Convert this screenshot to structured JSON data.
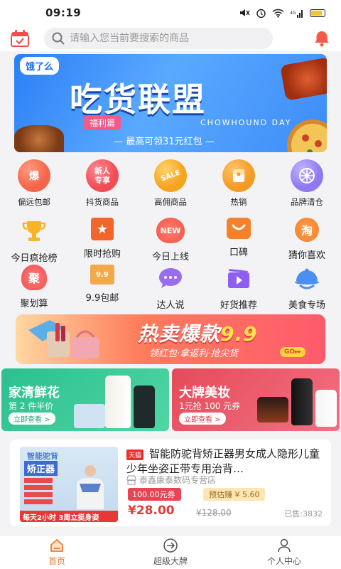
{
  "status_bar": {
    "time": "09:19",
    "icons": [
      "mute-icon",
      "alarm-icon",
      "wifi-icon",
      "signal-icon",
      "battery-icon"
    ],
    "battery_fraction": 0.85
  },
  "header": {
    "search_placeholder": "请输入您当前要搜索的商品",
    "left_icon": "calendar-check-icon",
    "right_icon": "bell-icon"
  },
  "banner": {
    "brand": "饿了么",
    "title": "吃货联盟",
    "tag": "福利篇",
    "sub": "CHOWHOUND DAY",
    "line": "— 最高可领31元红包 —"
  },
  "categories_row1": [
    {
      "label": "偏远包邮",
      "icon_text": "爆",
      "color": "#f4654a"
    },
    {
      "label": "抖货商品",
      "icon_text": "新人专享",
      "color": "#f24c55"
    },
    {
      "label": "高佣商品",
      "icon_text": "SALE",
      "color": "#f6a31f"
    },
    {
      "label": "热销",
      "icon_text": "",
      "color": "#f59a23"
    },
    {
      "label": "品牌清仓",
      "icon_text": "",
      "color": "#8f78f0"
    }
  ],
  "categories_row2": [
    {
      "label": "今日疯抢榜",
      "icon_text": "",
      "color": "#f7b526"
    },
    {
      "label": "限时抢购",
      "icon_text": "★",
      "color": "#f2662c"
    },
    {
      "label": "今日上线",
      "icon_text": "NEW",
      "color": "#f2554a"
    },
    {
      "label": "口碑",
      "icon_text": "",
      "color": "#f5812a"
    },
    {
      "label": "猜你喜欢",
      "icon_text": "淘",
      "color": "#f5812a"
    }
  ],
  "categories_row3": [
    {
      "label": "聚划算",
      "icon_text": "聚",
      "color": "#f25050"
    },
    {
      "label": "9.9包邮",
      "icon_text": "9.9",
      "color": "#f2a94a"
    },
    {
      "label": "达人说",
      "icon_text": "",
      "color": "#9a6cf2"
    },
    {
      "label": "好货推荐",
      "icon_text": "",
      "color": "#8e5ef0"
    },
    {
      "label": "美食专场",
      "icon_text": "",
      "color": "#4c8ff2"
    }
  ],
  "promo": {
    "title": "热卖爆款",
    "number": "9.9",
    "slogan": "领红包·拿返利·抢尖货",
    "go": "GO▸▸"
  },
  "dual_cards": [
    {
      "title": "家清鲜花",
      "sub": "第 2 件半价",
      "btn": "立即查看 >"
    },
    {
      "title": "大牌美妆",
      "sub": "1元抢 100 元券",
      "btn": "立即查看 >"
    }
  ],
  "product": {
    "tmall": "天猫",
    "name": "智能防驼背矫正器男女成人隐形儿童少年坐姿正带专用治背…",
    "shop": "泰鑫康泰数码专营店",
    "coupon": "100.00元券",
    "earn": "预估赚 ¥ 5.60",
    "price": "¥28.00",
    "old_price": "¥128.00",
    "sold": "已售:3832",
    "thumb_title": "智能驼背",
    "thumb_title2": "矫正器",
    "thumb_footer": "每天2小时 3周立挺身姿"
  },
  "tabbar": [
    {
      "label": "首页",
      "icon": "home-icon",
      "active": true
    },
    {
      "label": "超级大牌",
      "icon": "arrow-circle-icon",
      "active": false
    },
    {
      "label": "个人中心",
      "icon": "person-icon",
      "active": false
    }
  ]
}
